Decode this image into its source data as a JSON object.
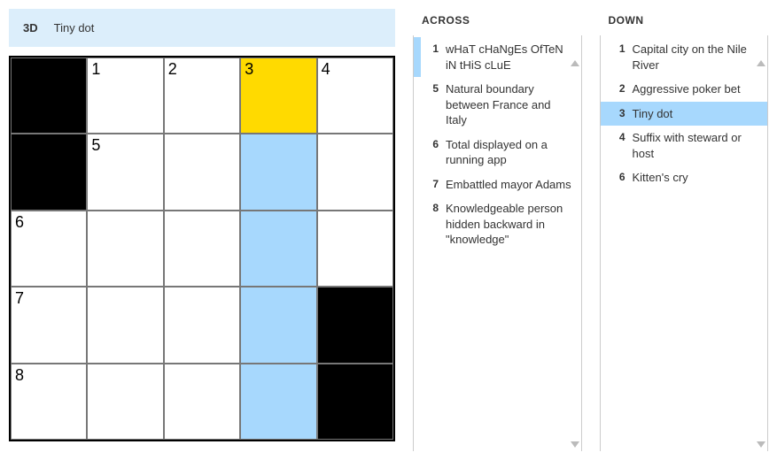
{
  "currentClue": {
    "label": "3D",
    "text": "Tiny dot"
  },
  "grid": {
    "rows": 5,
    "cols": 5,
    "cells": [
      [
        {
          "black": true
        },
        {
          "num": "1"
        },
        {
          "num": "2"
        },
        {
          "num": "3",
          "state": "cursor"
        },
        {
          "num": "4"
        }
      ],
      [
        {
          "black": true
        },
        {
          "num": "5"
        },
        {},
        {
          "state": "hl"
        },
        {}
      ],
      [
        {
          "num": "6"
        },
        {},
        {},
        {
          "state": "hl"
        },
        {}
      ],
      [
        {
          "num": "7"
        },
        {},
        {},
        {
          "state": "hl"
        },
        {
          "black": true
        }
      ],
      [
        {
          "num": "8"
        },
        {},
        {},
        {
          "state": "hl"
        },
        {
          "black": true
        }
      ]
    ]
  },
  "across": {
    "header": "ACROSS",
    "clues": [
      {
        "num": "1",
        "text": "wHaT cHaNgEs OfTeN iN tHiS cLuE",
        "related": true
      },
      {
        "num": "5",
        "text": "Natural boundary between France and Italy"
      },
      {
        "num": "6",
        "text": "Total displayed on a running app"
      },
      {
        "num": "7",
        "text": "Embattled mayor Adams"
      },
      {
        "num": "8",
        "text": "Knowledgeable person hidden backward in \"knowledge\""
      }
    ]
  },
  "down": {
    "header": "DOWN",
    "clues": [
      {
        "num": "1",
        "text": "Capital city on the Nile River"
      },
      {
        "num": "2",
        "text": "Aggressive poker bet"
      },
      {
        "num": "3",
        "text": "Tiny dot",
        "selected": true
      },
      {
        "num": "4",
        "text": "Suffix with steward or host"
      },
      {
        "num": "6",
        "text": "Kitten's cry"
      }
    ]
  }
}
